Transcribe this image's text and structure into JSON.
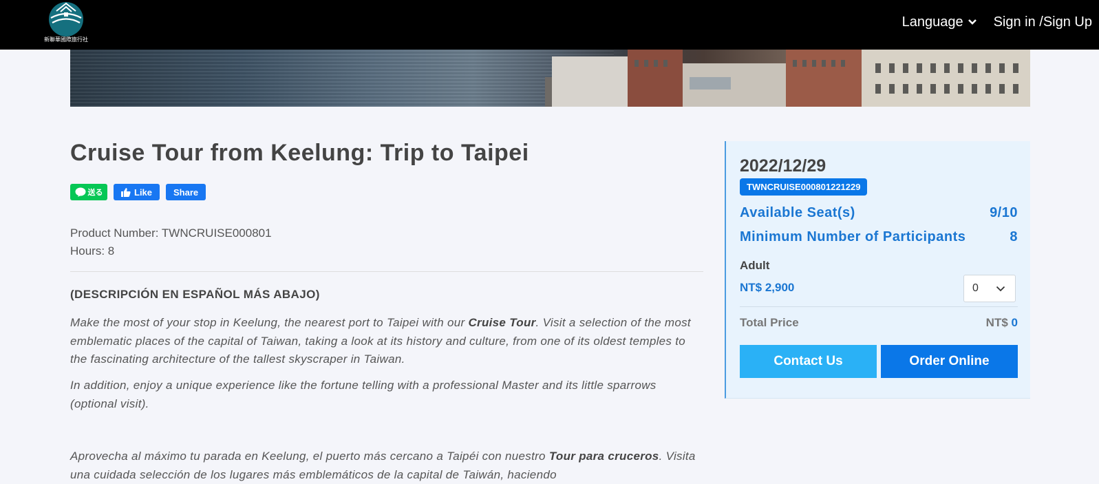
{
  "brand": {
    "logo_text": "新聯華國際旅行社"
  },
  "nav": {
    "language_label": "Language",
    "signin_label": "Sign in /Sign Up"
  },
  "product": {
    "title": "Cruise Tour from Keelung: Trip to Taipei",
    "number_label": "Product Number: TWNCRUISE000801",
    "hours_label": "Hours: 8"
  },
  "share": {
    "line_label": "送る",
    "like_label": "Like",
    "share_label": "Share"
  },
  "description": {
    "heading": "(DESCRIPCIÓN EN ESPAÑOL MÁS ABAJO)",
    "p1_a": "Make the most of your stop in Keelung, the nearest port to Taipei with our ",
    "p1_b": "Cruise Tour",
    "p1_c": ". Visit a selection of the most emblematic places of the capital of Taiwan, taking a look at its history and culture, from one of its oldest temples to the fascinating architecture of the tallest skyscraper in Taiwan.",
    "p2": "In addition, enjoy a unique experience like the fortune telling with a professional Master and its little sparrows (optional visit).",
    "p3_a": "Aprovecha al máximo tu parada en Keelung, el puerto más cercano a Taipéi con nuestro ",
    "p3_b": "Tour para cruceros",
    "p3_c": ". Visita una cuidada selección de los lugares más emblemáticos de la capital de Taiwán, haciendo"
  },
  "booking": {
    "date": "2022/12/29",
    "code": "TWNCRUISE000801221229",
    "seats_label": "Available Seat(s)",
    "seats_value": "9/10",
    "min_label": "Minimum Number of Participants",
    "min_value": "8",
    "adult_label": "Adult",
    "adult_price": "NT$ 2,900",
    "qty_value": "0",
    "total_label": "Total Price",
    "total_currency": "NT$",
    "total_value": "0",
    "contact_label": "Contact Us",
    "order_label": "Order Online"
  },
  "colors": {
    "navbar": "#000000",
    "accent_blue": "#0a77e8",
    "light_blue": "#2ab1f6",
    "line_green": "#06c755",
    "facebook": "#1877f2"
  }
}
